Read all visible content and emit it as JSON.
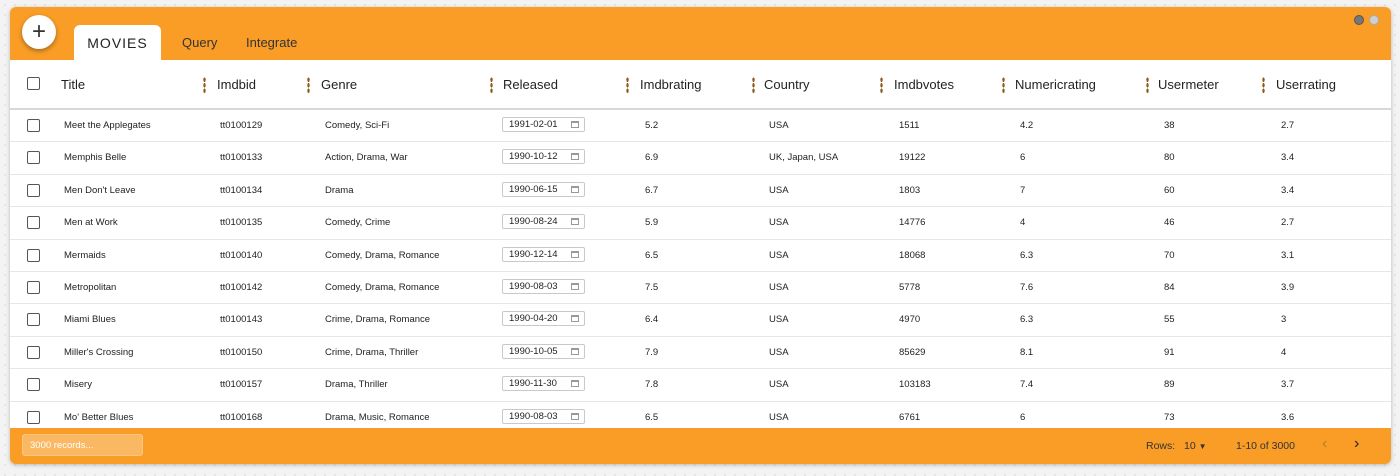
{
  "header": {
    "add_label": "+",
    "tabs": [
      "MOVIES",
      "Query",
      "Integrate"
    ]
  },
  "columns": [
    "Title",
    "Imdbid",
    "Genre",
    "Released",
    "Imdbrating",
    "Country",
    "Imdbvotes",
    "Numericrating",
    "Usermeter",
    "Userrating"
  ],
  "rows": [
    [
      "Meet the Applegates",
      "tt0100129",
      "Comedy, Sci-Fi",
      "1991-02-01",
      "5.2",
      "USA",
      "1511",
      "4.2",
      "38",
      "2.7"
    ],
    [
      "Memphis Belle",
      "tt0100133",
      "Action, Drama, War",
      "1990-10-12",
      "6.9",
      "UK, Japan, USA",
      "19122",
      "6",
      "80",
      "3.4"
    ],
    [
      "Men Don't Leave",
      "tt0100134",
      "Drama",
      "1990-06-15",
      "6.7",
      "USA",
      "1803",
      "7",
      "60",
      "3.4"
    ],
    [
      "Men at Work",
      "tt0100135",
      "Comedy, Crime",
      "1990-08-24",
      "5.9",
      "USA",
      "14776",
      "4",
      "46",
      "2.7"
    ],
    [
      "Mermaids",
      "tt0100140",
      "Comedy, Drama, Romance",
      "1990-12-14",
      "6.5",
      "USA",
      "18068",
      "6.3",
      "70",
      "3.1"
    ],
    [
      "Metropolitan",
      "tt0100142",
      "Comedy, Drama, Romance",
      "1990-08-03",
      "7.5",
      "USA",
      "5778",
      "7.6",
      "84",
      "3.9"
    ],
    [
      "Miami Blues",
      "tt0100143",
      "Crime, Drama, Romance",
      "1990-04-20",
      "6.4",
      "USA",
      "4970",
      "6.3",
      "55",
      "3"
    ],
    [
      "Miller's Crossing",
      "tt0100150",
      "Crime, Drama, Thriller",
      "1990-10-05",
      "7.9",
      "USA",
      "85629",
      "8.1",
      "91",
      "4"
    ],
    [
      "Misery",
      "tt0100157",
      "Drama, Thriller",
      "1990-11-30",
      "7.8",
      "USA",
      "103183",
      "7.4",
      "89",
      "3.7"
    ],
    [
      "Mo' Better Blues",
      "tt0100168",
      "Drama, Music, Romance",
      "1990-08-03",
      "6.5",
      "USA",
      "6761",
      "6",
      "73",
      "3.6"
    ]
  ],
  "footer": {
    "search_placeholder": "3000 records...",
    "rows_label": "Rows:",
    "rows_value": "10",
    "range_text": "1-10 of 3000",
    "prev_icon": "‹",
    "next_icon": "›"
  },
  "colors": {
    "accent": "#f99d27"
  }
}
